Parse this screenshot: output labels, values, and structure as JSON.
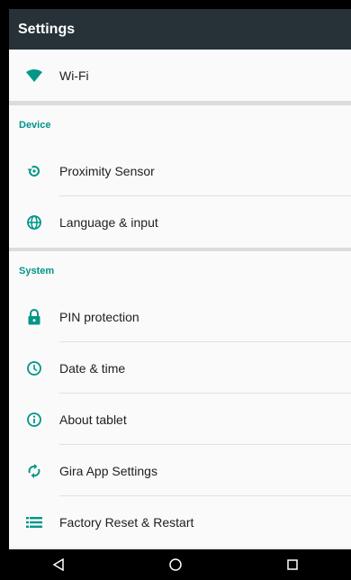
{
  "appbar": {
    "title": "Settings"
  },
  "wifi": {
    "label": "Wi-Fi"
  },
  "device": {
    "title": "Device",
    "items": [
      {
        "label": "Proximity Sensor",
        "icon": "proximity-sensor-icon"
      },
      {
        "label": "Language & input",
        "icon": "globe-icon"
      }
    ]
  },
  "system": {
    "title": "System",
    "items": [
      {
        "label": "PIN protection",
        "icon": "lock-icon"
      },
      {
        "label": "Date & time",
        "icon": "clock-icon"
      },
      {
        "label": "About tablet",
        "icon": "info-icon"
      },
      {
        "label": "Gira App Settings",
        "icon": "sync-icon"
      },
      {
        "label": "Factory Reset & Restart",
        "icon": "list-icon"
      }
    ]
  },
  "navbar": {
    "buttons": [
      "back-icon",
      "home-icon",
      "recents-icon"
    ]
  },
  "colors": {
    "accent": "#009688",
    "appbar": "#263238",
    "background": "#ececec"
  }
}
